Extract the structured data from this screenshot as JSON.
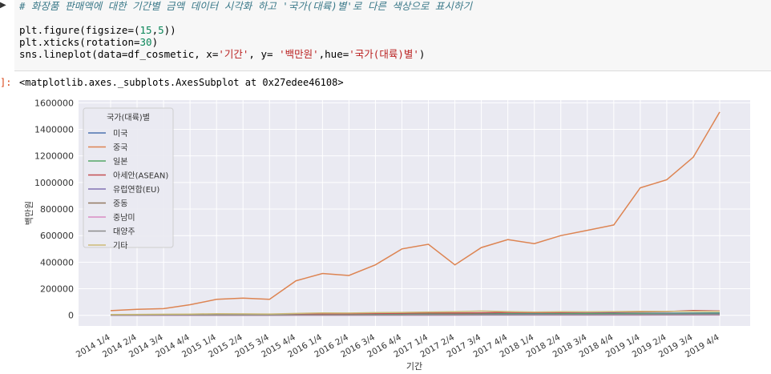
{
  "cell": {
    "comment": "# 화장품 판매액에 대한 기간별 금액 데이터 시각화 하고 '국가(대륙)별'로 다른 색상으로 표시하기",
    "line1_a": "plt.figure(figsize=(",
    "line1_b": "15",
    "line1_c": ",",
    "line1_d": "5",
    "line1_e": "))",
    "line2_a": "plt.xticks(rotation=",
    "line2_b": "30",
    "line2_c": ")",
    "line3_a": "sns.lineplot(data=df_cosmetic, x=",
    "line3_b": "'기간'",
    "line3_c": ", y= ",
    "line3_d": "'백만원'",
    "line3_e": ",hue=",
    "line3_f": "'국가(대륙)별'",
    "line3_g": ")"
  },
  "output": {
    "prompt": "]:",
    "text": "<matplotlib.axes._subplots.AxesSubplot at 0x27edee46108>"
  },
  "chart_data": {
    "type": "line",
    "xlabel": "기간",
    "ylabel": "백만원",
    "ylim": [
      -80000,
      1620000
    ],
    "yticks": [
      0,
      200000,
      400000,
      600000,
      800000,
      1000000,
      1200000,
      1400000,
      1600000
    ],
    "ytick_labels": [
      "0",
      "200000",
      "400000",
      "600000",
      "800000",
      "1000000",
      "1200000",
      "1400000",
      "1600000"
    ],
    "legend_title": "국가(대륙)별",
    "legend_position": "top-left",
    "grid": true,
    "categories": [
      "2014 1/4",
      "2014 2/4",
      "2014 3/4",
      "2014 4/4",
      "2015 1/4",
      "2015 2/4",
      "2015 3/4",
      "2015 4/4",
      "2016 1/4",
      "2016 2/4",
      "2016 3/4",
      "2016 4/4",
      "2017 1/4",
      "2017 2/4",
      "2017 3/4",
      "2017 4/4",
      "2018 1/4",
      "2018 2/4",
      "2018 3/4",
      "2018 4/4",
      "2019 1/4",
      "2019 2/4",
      "2019 3/4",
      "2019 4/4"
    ],
    "series": [
      {
        "name": "미국",
        "color": "#4c72b0",
        "values": [
          3000,
          3500,
          3500,
          4000,
          5000,
          5500,
          5000,
          6000,
          7000,
          7000,
          8000,
          9000,
          10000,
          11000,
          12000,
          13000,
          13000,
          14000,
          14000,
          15000,
          16000,
          16000,
          17000,
          18000
        ]
      },
      {
        "name": "중국",
        "color": "#dd8452",
        "values": [
          35000,
          45000,
          50000,
          80000,
          120000,
          130000,
          120000,
          260000,
          315000,
          300000,
          380000,
          500000,
          535000,
          380000,
          510000,
          570000,
          540000,
          600000,
          640000,
          680000,
          960000,
          1020000,
          1190000,
          1530000
        ]
      },
      {
        "name": "일본",
        "color": "#55a868",
        "values": [
          2000,
          2500,
          2500,
          3000,
          8000,
          4000,
          3000,
          5000,
          6000,
          6000,
          7000,
          8000,
          9000,
          9000,
          10000,
          11000,
          10000,
          11000,
          12000,
          12000,
          14000,
          13000,
          15000,
          16000
        ]
      },
      {
        "name": "아세안(ASEAN)",
        "color": "#c44e52",
        "values": [
          5000,
          6000,
          6500,
          7000,
          9000,
          9000,
          8000,
          10000,
          12000,
          13000,
          14000,
          16000,
          18000,
          17000,
          19000,
          22000,
          21000,
          22000,
          23000,
          24000,
          26000,
          28000,
          36000,
          32000
        ]
      },
      {
        "name": "유럽연합(EU)",
        "color": "#8172b3",
        "values": [
          1000,
          1000,
          1500,
          1500,
          2000,
          2000,
          2000,
          2500,
          3000,
          3000,
          3500,
          4000,
          4500,
          4500,
          5000,
          5500,
          5500,
          6000,
          6500,
          7000,
          7500,
          8000,
          8500,
          9000
        ]
      },
      {
        "name": "중동",
        "color": "#937860",
        "values": [
          500,
          600,
          700,
          800,
          900,
          1000,
          1000,
          1200,
          1500,
          1500,
          1800,
          2000,
          2200,
          2300,
          2500,
          2700,
          2800,
          3000,
          3200,
          3400,
          3600,
          3800,
          4000,
          4200
        ]
      },
      {
        "name": "중남미",
        "color": "#da8bc3",
        "values": [
          300,
          300,
          400,
          400,
          500,
          500,
          500,
          600,
          700,
          700,
          800,
          900,
          1000,
          1000,
          1100,
          1200,
          1200,
          1300,
          1400,
          1500,
          1600,
          1700,
          1800,
          1900
        ]
      },
      {
        "name": "대양주",
        "color": "#8c8c8c",
        "values": [
          1500,
          1600,
          1700,
          1800,
          2000,
          2200,
          2200,
          2500,
          2800,
          2900,
          3000,
          3200,
          3500,
          3500,
          3800,
          4000,
          4100,
          4300,
          4500,
          4700,
          5000,
          5200,
          5400,
          5600
        ]
      },
      {
        "name": "기타",
        "color": "#ccb974",
        "values": [
          6000,
          7000,
          8000,
          9000,
          12000,
          11000,
          10000,
          14000,
          18000,
          17000,
          20000,
          22000,
          25000,
          27000,
          32000,
          28000,
          25000,
          27000,
          26000,
          28000,
          30000,
          29000,
          31000,
          30000
        ]
      }
    ]
  }
}
